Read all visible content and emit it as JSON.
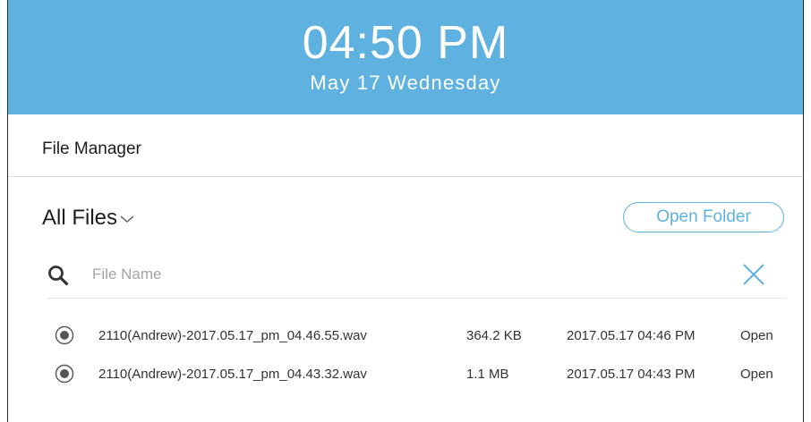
{
  "header": {
    "time": "04:50 PM",
    "date": "May 17 Wednesday"
  },
  "section": {
    "title": "File Manager"
  },
  "toolbar": {
    "filter_label": "All Files",
    "open_folder_label": "Open Folder"
  },
  "search": {
    "placeholder": "File Name",
    "value": ""
  },
  "files": [
    {
      "name": "2110(Andrew)-2017.05.17_pm_04.46.55.wav",
      "size": "364.2 KB",
      "date": "2017.05.17 04:46 PM",
      "action": "Open"
    },
    {
      "name": "2110(Andrew)-2017.05.17_pm_04.43.32.wav",
      "size": "1.1 MB",
      "date": "2017.05.17 04:43 PM",
      "action": "Open"
    }
  ],
  "colors": {
    "accent": "#5fb2e0",
    "text": "#1d1d1d",
    "muted": "#a4a4a4"
  },
  "icons": {
    "search": "search-icon",
    "clear": "close-icon",
    "filter": "chevron-down-icon",
    "row_select": "radio-icon"
  }
}
